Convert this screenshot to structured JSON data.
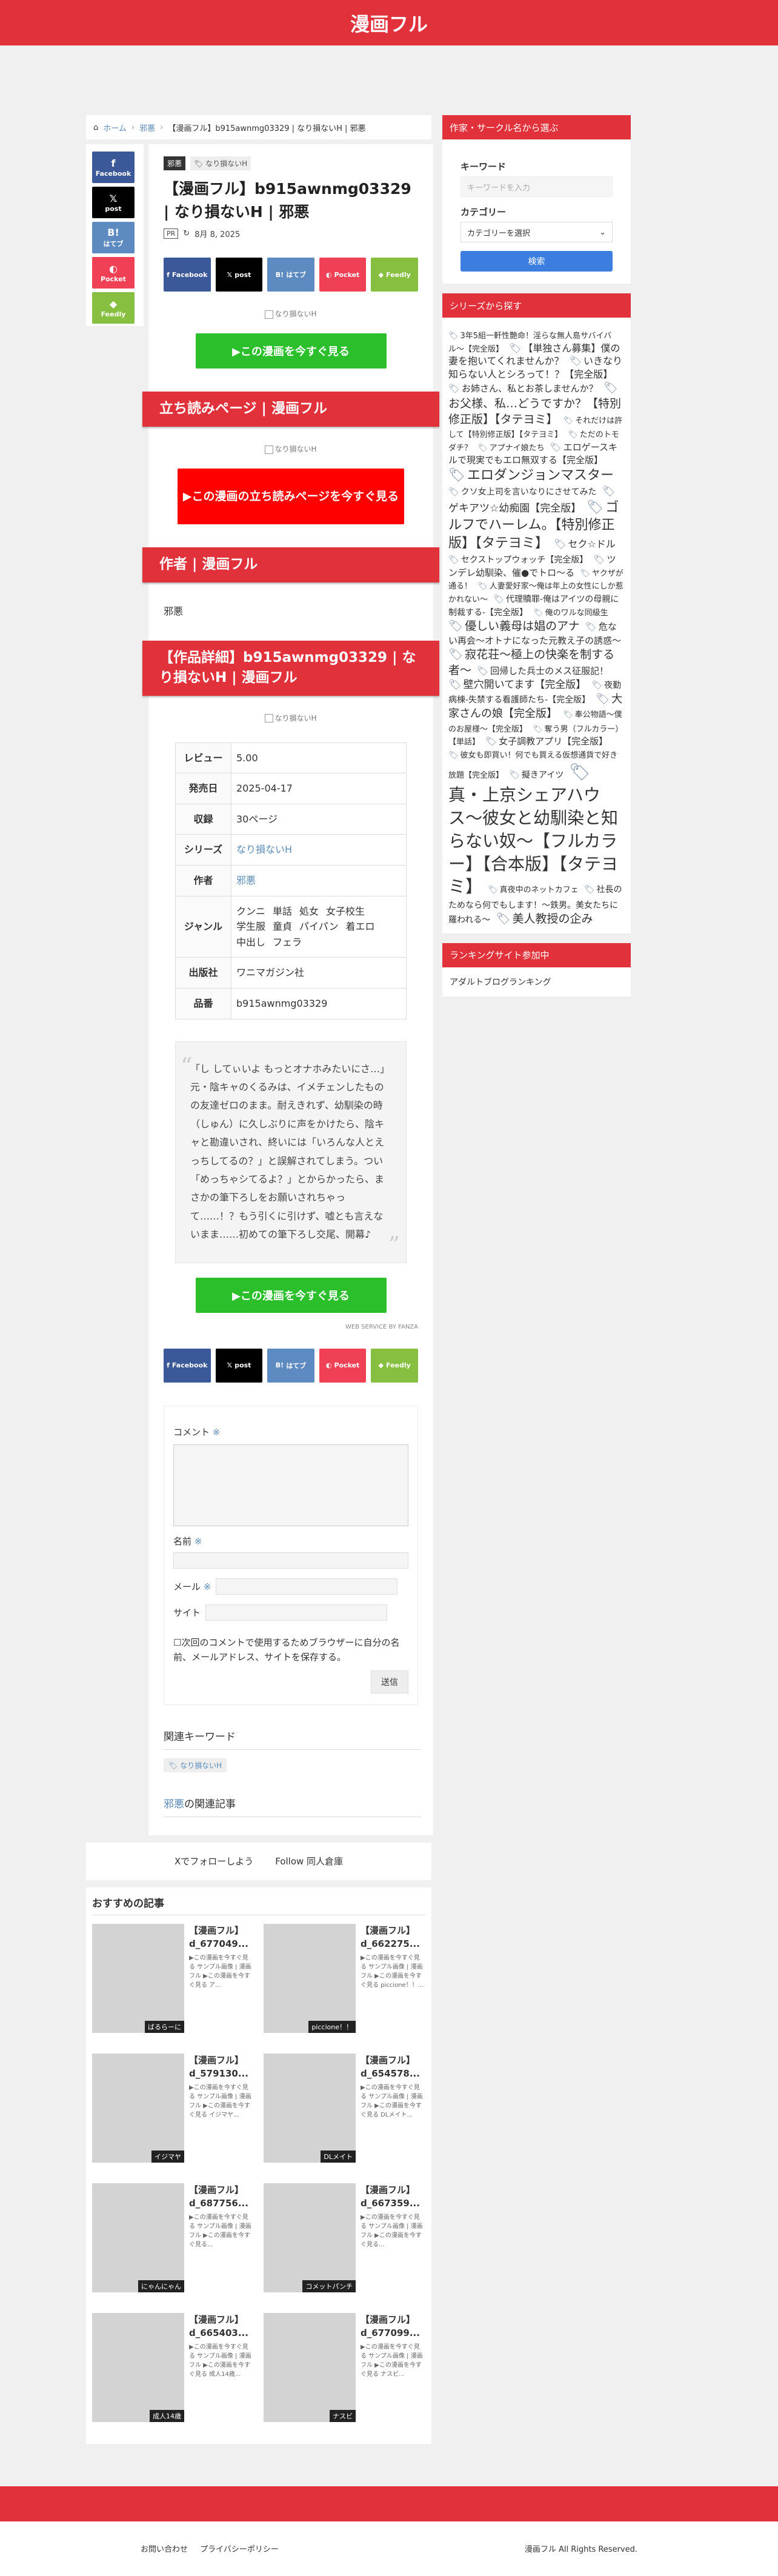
{
  "site": {
    "title": "漫画フル"
  },
  "breadcrumb": {
    "home": "ホーム",
    "cat": "邪悪",
    "current": "【漫画フル】b915awnmg03329 | なり損ないH | 邪悪"
  },
  "sns": {
    "facebook": "Facebook",
    "x": "post",
    "hatena": "はてブ",
    "pocket": "Pocket",
    "feedly": "Feedly",
    "x_icon": "𝕏",
    "hatena_icon": "B!"
  },
  "post": {
    "category": "邪悪",
    "tag": "なり損ないH",
    "title": "【漫画フル】b915awnmg03329 | なり損ないH | 邪悪",
    "pr": "PR",
    "date": "8月 8, 2025",
    "img_alt1": "なり損ないH",
    "img_alt2": "なり損ないH",
    "img_alt3": "なり損ないH",
    "cta1": "▶この漫画を今すぐ見る",
    "sec_tachiyomi": "立ち読みページ | 漫画フル",
    "cta_red": "▶この漫画の立ち読みページを今すぐ見る",
    "sec_author": "作者 | 漫画フル",
    "author": "邪悪",
    "sec_detail": "【作品詳細】b915awnmg03329 | なり損ないH | 漫画フル",
    "cta2": "▶この漫画を今すぐ見る",
    "credit": "WEB SERVICE BY FANZA"
  },
  "spec": [
    {
      "k": "レビュー",
      "v": "5.00"
    },
    {
      "k": "発売日",
      "v": "2025-04-17"
    },
    {
      "k": "収録",
      "v": "30ページ"
    },
    {
      "k": "シリーズ",
      "v": "なり損ないH",
      "link": true
    },
    {
      "k": "作者",
      "v": "邪悪",
      "link": true
    },
    {
      "k": "ジャンル",
      "tags": [
        "クンニ",
        "単話",
        "処女",
        "女子校生",
        "学生服",
        "童貞",
        "パイパン",
        "着エロ",
        "中出し",
        "フェラ"
      ]
    },
    {
      "k": "出版社",
      "v": "ワニマガジン社"
    },
    {
      "k": "品番",
      "v": "b915awnmg03329"
    }
  ],
  "quote": "「し してぃいよ もっとオナホみたいにさ…」元・陰キャのくるみは、イメチェンしたものの友達ゼロのまま。耐えきれず、幼馴染の時（しゅん）に久しぶりに声をかけたら、陰キャと勘違いされ、終いには「いろんな人とえっちしてるの？」と誤解されてしまう。つい「めっちゃシてるよ？」とからかったら、まさかの筆下ろしをお願いされちゃって……！？もう引くに引けず、嘘とも言えないまま……初めての筆下ろし交尾、開幕♪",
  "comment": {
    "label": "コメント",
    "req": "※",
    "name": "名前",
    "mail": "メール",
    "site": "サイト",
    "save": "次回のコメントで使用するためブラウザーに自分の名前、メールアドレス、サイトを保存する。",
    "submit": "送信"
  },
  "related": {
    "kw_title": "関連キーワード",
    "kw": "なり損ないH",
    "author_link": "邪悪",
    "articles": "の関連記事"
  },
  "follow": {
    "x": "Xでフォローしよう",
    "dojin": "Follow 同人倉庫"
  },
  "recommend": {
    "title": "おすすめの記事",
    "items": [
      {
        "title": "【漫画フル】d_677049...",
        "desc": "▶この漫画を今すぐ見る サンプル画像 | 漫画フル ▶この漫画を今すぐ見る ア...",
        "label": "ばるらーに"
      },
      {
        "title": "【漫画フル】d_662275...",
        "desc": "▶この漫画を今すぐ見る サンプル画像 | 漫画フル ▶この漫画を今すぐ見る piccione！！...",
        "label": "piccione！！"
      },
      {
        "title": "【漫画フル】d_579130...",
        "desc": "▶この漫画を今すぐ見る サンプル画像 | 漫画フル ▶この漫画を今すぐ見る イジマヤ...",
        "label": "イジマヤ"
      },
      {
        "title": "【漫画フル】d_654578...",
        "desc": "▶この漫画を今すぐ見る サンプル画像 | 漫画フル ▶この漫画を今すぐ見る DLメイト...",
        "label": "DLメイト"
      },
      {
        "title": "【漫画フル】d_687756...",
        "desc": "▶この漫画を今すぐ見る サンプル画像 | 漫画フル ▶この漫画を今すぐ見る...",
        "label": "にゃんにゃん"
      },
      {
        "title": "【漫画フル】d_667359...",
        "desc": "▶この漫画を今すぐ見る サンプル画像 | 漫画フル ▶この漫画を今すぐ見る...",
        "label": "コメットパンチ"
      },
      {
        "title": "【漫画フル】d_665403...",
        "desc": "▶この漫画を今すぐ見る サンプル画像 | 漫画フル ▶この漫画を今すぐ見る 成人14歳...",
        "label": "成人14歳"
      },
      {
        "title": "【漫画フル】d_677099...",
        "desc": "▶この漫画を今すぐ見る サンプル画像 | 漫画フル ▶この漫画を今すぐ見る ナスビ...",
        "label": "ナスビ"
      }
    ]
  },
  "search": {
    "title": "作家・サークル名から選ぶ",
    "kw_label": "キーワード",
    "kw_ph": "キーワードを入力",
    "cat_label": "カテゴリー",
    "cat_ph": "カテゴリーを選択",
    "button": "検索"
  },
  "series": {
    "title": "シリーズから探す",
    "tags": [
      {
        "t": "3年5組一軒性艶命！淫らな無人島サバイバル〜【完全版】",
        "s": 13
      },
      {
        "t": "【単独さん募集】僕の妻を抱いてくれませんか？",
        "s": 16
      },
      {
        "t": "いきなり知らない人とシろって！？【完全版】",
        "s": 16
      },
      {
        "t": "お姉さん、私とお茶しませんか？",
        "s": 15
      },
      {
        "t": "お父様、私…どうですか？【特別修正版】【タテヨミ】",
        "s": 19
      },
      {
        "t": "それだけは許して【特別修正版】【タテヨミ】",
        "s": 13
      },
      {
        "t": "ただのトモダチ？",
        "s": 13
      },
      {
        "t": "アプナイ娘たち",
        "s": 13
      },
      {
        "t": "エロゲースキルで現実でもエロ無双する【完全版】",
        "s": 15
      },
      {
        "t": "エロダンジョンマスター",
        "s": 22
      },
      {
        "t": "クソ女上司を言いなりにさせてみた",
        "s": 14
      },
      {
        "t": "ゲキアツ☆幼痴園【完全版】",
        "s": 17
      },
      {
        "t": "ゴルフでハーレム。【特別修正版】【タテヨミ】",
        "s": 22
      },
      {
        "t": "セク☆ドル",
        "s": 16
      },
      {
        "t": "セクストップウォッチ【完全版】",
        "s": 14
      },
      {
        "t": "ツンデレ幼馴染、催●でトロ〜る",
        "s": 15
      },
      {
        "t": "ヤクザが通る！",
        "s": 13
      },
      {
        "t": "人妻愛好家〜俺は年上の女性にしか惹かれない〜",
        "s": 13
      },
      {
        "t": "代理贖罪-俺はアイツの母親に制裁する-【完全版】",
        "s": 14
      },
      {
        "t": "俺のワルな同級生",
        "s": 13
      },
      {
        "t": "優しい義母は娼のアナ",
        "s": 19
      },
      {
        "t": "危ない再会〜オトナになった元教え子の誘惑〜",
        "s": 15
      },
      {
        "t": "寂花荘〜極上の快楽を制する者〜",
        "s": 19
      },
      {
        "t": "回帰した兵士のメス征服記！",
        "s": 15
      },
      {
        "t": "壁穴開いてます【完全版】",
        "s": 17
      },
      {
        "t": "夜勤病棟-失禁する看護師たち-【完全版】",
        "s": 14
      },
      {
        "t": "大家さんの娘【完全版】",
        "s": 18
      },
      {
        "t": "奉公物語〜僕のお屋様〜【完全版】",
        "s": 13
      },
      {
        "t": "奪う男（フルカラー）【単話】",
        "s": 13
      },
      {
        "t": "女子調教アプリ【完全版】",
        "s": 15
      },
      {
        "t": "彼女も即買い！何でも買える仮想通貨で好き放題【完全版】",
        "s": 13
      },
      {
        "t": "擬きアイツ",
        "s": 14
      },
      {
        "t": "真・上京シェアハウス〜彼女と幼馴染と知らない奴〜【フルカラー】【合本版】【タテヨミ】",
        "s": 28
      },
      {
        "t": "真夜中のネットカフェ",
        "s": 13
      },
      {
        "t": "社長のためなら何でもします！〜鉄男。美女たちに羅われる〜",
        "s": 14
      },
      {
        "t": "美人教授の企み",
        "s": 19
      }
    ]
  },
  "ranking": {
    "title": "ランキングサイト参加中",
    "item": "アダルトブログランキング"
  },
  "footer": {
    "contact": "お問い合わせ",
    "privacy": "プライバシーポリシー",
    "copy": "漫画フル All Rights Reserved."
  }
}
